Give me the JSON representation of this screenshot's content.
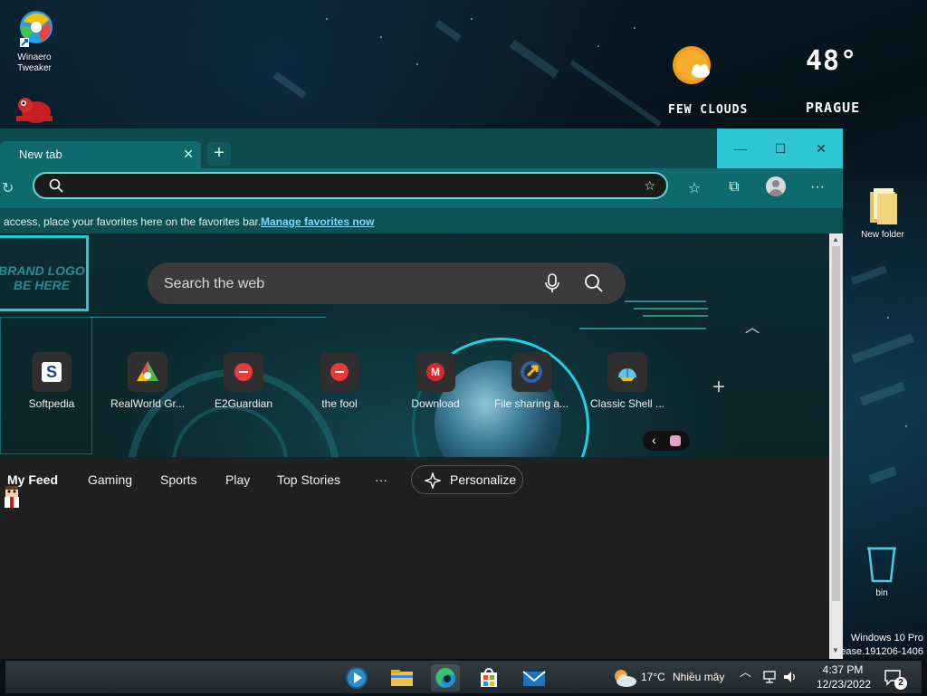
{
  "desktop": {
    "icons": [
      {
        "label": "Winaero Tweaker"
      },
      {
        "label": "New folder"
      },
      {
        "label": "bin"
      }
    ],
    "weather_widget": {
      "condition": "FEW CLOUDS",
      "temperature": "48°",
      "city": "PRAGUE"
    },
    "watermark": {
      "line1": "Windows 10 Pro",
      "line2": "ease.191206-1406"
    }
  },
  "browser": {
    "tab": {
      "title": "New tab"
    },
    "window_buttons": {
      "minimize": "—",
      "maximize": "☐",
      "close": "✕"
    },
    "address_bar": {
      "value": ""
    },
    "favorites_bar": {
      "message": "access, place your favorites here on the favorites bar.",
      "link": "Manage favorites now"
    },
    "brand_logo": "BRAND LOGO BE HERE",
    "search": {
      "placeholder": "Search the web"
    },
    "quick_links": [
      {
        "label": "Softpedia"
      },
      {
        "label": "RealWorld Gr..."
      },
      {
        "label": "E2Guardian"
      },
      {
        "label": "the fool"
      },
      {
        "label": "Download"
      },
      {
        "label": "File sharing a..."
      },
      {
        "label": "Classic Shell ..."
      }
    ],
    "feed_tabs": [
      {
        "label": "My Feed",
        "active": true
      },
      {
        "label": "Gaming"
      },
      {
        "label": "Sports"
      },
      {
        "label": "Play"
      },
      {
        "label": "Top Stories"
      }
    ],
    "more_label": "···",
    "personalize_label": "Personalize"
  },
  "taskbar": {
    "weather": {
      "temp": "17°C",
      "condition": "Nhiều mây"
    },
    "clock": {
      "time": "4:37 PM",
      "date": "12/23/2022"
    },
    "notifications_count": "2"
  }
}
